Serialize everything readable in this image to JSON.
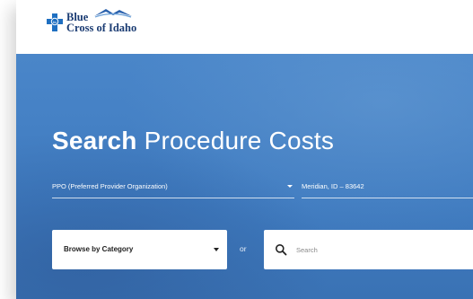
{
  "brand": {
    "line1": "Blue",
    "line2": "Cross of Idaho",
    "logo_icon": "blue-cross-shield-icon",
    "mountain_icon": "mountain-swoosh-icon",
    "colors": {
      "brand": "#1b3c73",
      "hero": "#4382c6"
    }
  },
  "hero": {
    "title_bold": "Search",
    "title_rest": "Procedure Costs"
  },
  "filters": {
    "plan": {
      "value": "PPO (Preferred Provider Organization)",
      "icon": "caret-down-icon"
    },
    "location": {
      "value": "Meridian, ID – 83642"
    }
  },
  "search": {
    "browse_label": "Browse by Category",
    "or_label": "or",
    "placeholder": "Search",
    "search_icon": "search-icon"
  }
}
